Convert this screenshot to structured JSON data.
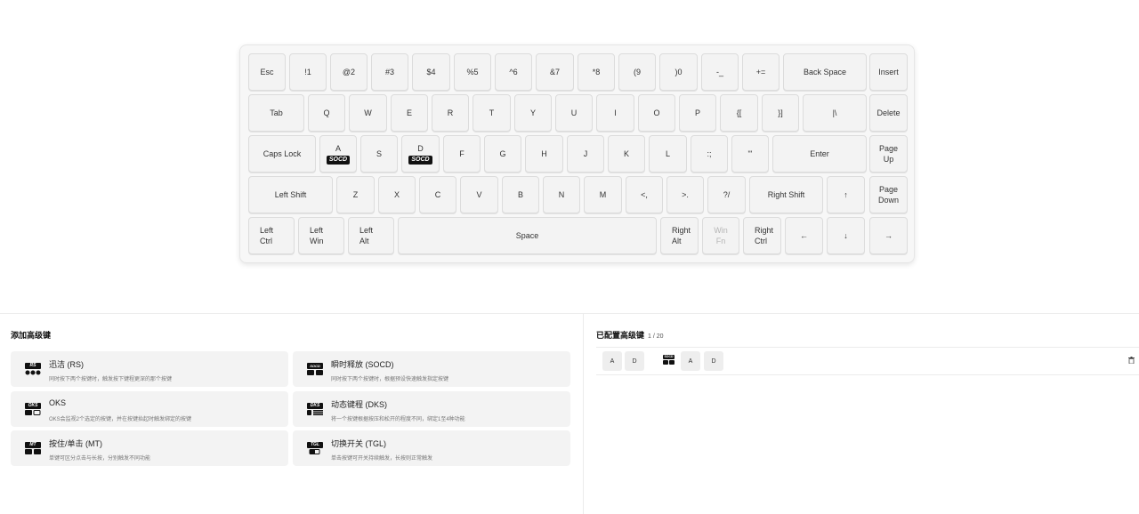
{
  "keyboard": {
    "rows": [
      [
        {
          "label": "Esc"
        },
        {
          "label": "!1"
        },
        {
          "label": "@2"
        },
        {
          "label": "#3"
        },
        {
          "label": "$4"
        },
        {
          "label": "%5"
        },
        {
          "label": "^6"
        },
        {
          "label": "&7"
        },
        {
          "label": "*8"
        },
        {
          "label": "(9"
        },
        {
          "label": ")0"
        },
        {
          "label": "-_"
        },
        {
          "label": "+="
        },
        {
          "label": "Back Space"
        },
        {
          "label": "Insert"
        }
      ],
      [
        {
          "label": "Tab"
        },
        {
          "label": "Q"
        },
        {
          "label": "W"
        },
        {
          "label": "E"
        },
        {
          "label": "R"
        },
        {
          "label": "T"
        },
        {
          "label": "Y"
        },
        {
          "label": "U"
        },
        {
          "label": "I"
        },
        {
          "label": "O"
        },
        {
          "label": "P"
        },
        {
          "label": "{["
        },
        {
          "label": "}]"
        },
        {
          "label": "|\\"
        },
        {
          "label": "Delete"
        }
      ],
      [
        {
          "label": "Caps Lock"
        },
        {
          "label": "A",
          "tag": "SOCD"
        },
        {
          "label": "S"
        },
        {
          "label": "D",
          "tag": "SOCD"
        },
        {
          "label": "F"
        },
        {
          "label": "G"
        },
        {
          "label": "H"
        },
        {
          "label": "J"
        },
        {
          "label": "K"
        },
        {
          "label": "L"
        },
        {
          "label": ":;"
        },
        {
          "label": "\"'"
        },
        {
          "label": "Enter"
        },
        {
          "label": "Page Up"
        }
      ],
      [
        {
          "label": "Left Shift"
        },
        {
          "label": "Z"
        },
        {
          "label": "X"
        },
        {
          "label": "C"
        },
        {
          "label": "V"
        },
        {
          "label": "B"
        },
        {
          "label": "N"
        },
        {
          "label": "M"
        },
        {
          "label": "<,"
        },
        {
          "label": ">."
        },
        {
          "label": "?/"
        },
        {
          "label": "Right Shift"
        },
        {
          "label": "↑"
        },
        {
          "label": "Page Down"
        }
      ],
      [
        {
          "label": "Left Ctrl"
        },
        {
          "label": "Left Win"
        },
        {
          "label": "Left Alt"
        },
        {
          "label": "Space"
        },
        {
          "label": "Right Alt"
        },
        {
          "label": "Win Fn",
          "dim": true
        },
        {
          "label": "Right Ctrl"
        },
        {
          "label": "←"
        },
        {
          "label": "↓"
        },
        {
          "label": "→"
        }
      ]
    ]
  },
  "add_section": {
    "title": "添加高级键",
    "cards": [
      {
        "title": "迅洁 (RS)",
        "desc": "同时按下两个按键时，触发按下键程更深的那个按键",
        "icon": "rs-icon",
        "badge": "RS"
      },
      {
        "title": "瞬时释放 (SOCD)",
        "desc": "同时按下两个按键时，根据预设快速触发指定按键",
        "icon": "socd-icon",
        "badge": "SOCD"
      },
      {
        "title": "OKS",
        "desc": "OKS会监视2个选定的按键，并在按键抬起时触发绑定的按键",
        "icon": "oks-icon",
        "badge": "OKS"
      },
      {
        "title": "动态键程 (DKS)",
        "desc": "将一个按键根据按压和松开的程度不同，绑定1至4种功能",
        "icon": "dks-icon",
        "badge": "DKS"
      },
      {
        "title": "按住/单击 (MT)",
        "desc": "单键可区分点击与长按，分别触发不同功能",
        "icon": "mt-icon",
        "badge": "MT"
      },
      {
        "title": "切换开关 (TGL)",
        "desc": "单击按键可开关持续触发，长按则正常触发",
        "icon": "tgl-icon",
        "badge": "TGL"
      }
    ]
  },
  "configured_section": {
    "title": "已配置高级键",
    "count": "1 / 20",
    "entries": [
      {
        "keys": [
          "A",
          "D"
        ],
        "badge": "SOCD",
        "bound": [
          "A",
          "D"
        ]
      }
    ]
  }
}
